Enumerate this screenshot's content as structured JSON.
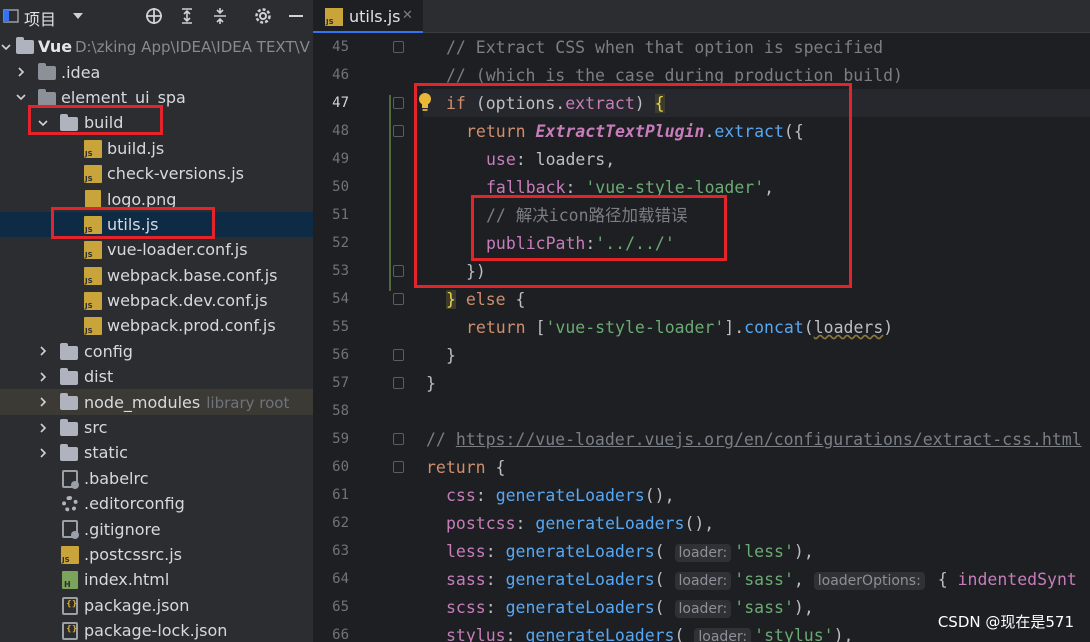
{
  "panel": {
    "title": "项目"
  },
  "tree": {
    "root_name": "Vue",
    "root_path": "D:\\zking App\\IDEA\\IDEA TEXT\\V",
    "idea": ".idea",
    "element_ui_spa": "element_ui_spa",
    "build": "build",
    "build_files": [
      "build.js",
      "check-versions.js",
      "logo.png",
      "utils.js",
      "vue-loader.conf.js",
      "webpack.base.conf.js",
      "webpack.dev.conf.js",
      "webpack.prod.conf.js"
    ],
    "config": "config",
    "dist": "dist",
    "node_modules": "node_modules",
    "node_modules_hint": "library root",
    "src": "src",
    "static": "static",
    "babelrc": ".babelrc",
    "editorconfig": ".editorconfig",
    "gitignore": ".gitignore",
    "postcssrc": ".postcssrc.js",
    "index": "index.html",
    "package": "package.json",
    "package_lock": "package-lock.json"
  },
  "editor": {
    "tab_label": "utils.js",
    "tab_close": "✕",
    "line_numbers": [
      "45",
      "46",
      "47",
      "48",
      "49",
      "50",
      "51",
      "52",
      "53",
      "54",
      "55",
      "56",
      "57",
      "58",
      "59",
      "60",
      "61",
      "62",
      "63",
      "64",
      "65",
      "66"
    ],
    "code": {
      "l45": "// Extract CSS when that option is specified",
      "l46": "// (which is the case during production build)",
      "l47_kw": "if",
      "l47_a": " (options.",
      "l47_prop": "extract",
      "l47_b": ") ",
      "l47_brace": "{",
      "l48_kw": "return",
      "l48_cls": "ExtractTextPlugin",
      "l48_dot": ".",
      "l48_mth": "extract",
      "l48_end": "({",
      "l49_prop": "use",
      "l49_rest": ": loaders,",
      "l50_prop": "fallback",
      "l50_colon": ": ",
      "l50_str": "'vue-style-loader'",
      "l50_end": ",",
      "l51": "// 解决icon路径加载错误",
      "l52_prop": "publicPath",
      "l52_colon": ":",
      "l52_str": "'../../'",
      "l53": "})",
      "l54_brace": "}",
      "l54_kw": " else ",
      "l54_end": "{",
      "l55_kw": "return",
      "l55_a": " [",
      "l55_str": "'vue-style-loader'",
      "l55_b": "].",
      "l55_mth": "concat",
      "l55_c": "(",
      "l55_arg": "loaders",
      "l55_d": ")",
      "l56": "}",
      "l57": "}",
      "l59_cm": "// ",
      "l59_link": "https://vue-loader.vuejs.org/en/configurations/extract-css.html",
      "l60_kw": "return",
      "l60_end": " {",
      "l61_prop": "css",
      "l61_fn": "generateLoaders",
      "l61_end": "(),",
      "l62_prop": "postcss",
      "l62_fn": "generateLoaders",
      "l62_end": "(),",
      "l63_prop": "less",
      "l63_fn": "generateLoaders",
      "l63_hint": "loader:",
      "l63_str": "'less'",
      "l63_end": "),",
      "l64_prop": "sass",
      "l64_fn": "generateLoaders",
      "l64_hint": "loader:",
      "l64_str": "'sass'",
      "l64_mid": ", ",
      "l64_hint2": "loaderOptions:",
      "l64_tail_a": " { ",
      "l64_tail_prop": "indentedSynt",
      "l65_prop": "scss",
      "l65_fn": "generateLoaders",
      "l65_hint": "loader:",
      "l65_str": "'sass'",
      "l65_end": "),",
      "l66_prop": "stylus",
      "l66_fn": "generateLoaders",
      "l66_hint": "loader:",
      "l66_str": "'stylus'",
      "l66_end": "),"
    }
  },
  "watermark": "CSDN @现在是571",
  "colors": {
    "annotation_red": "#e3242b",
    "selection_blue": "#0d2b45",
    "accent_blue": "#3574f0"
  }
}
